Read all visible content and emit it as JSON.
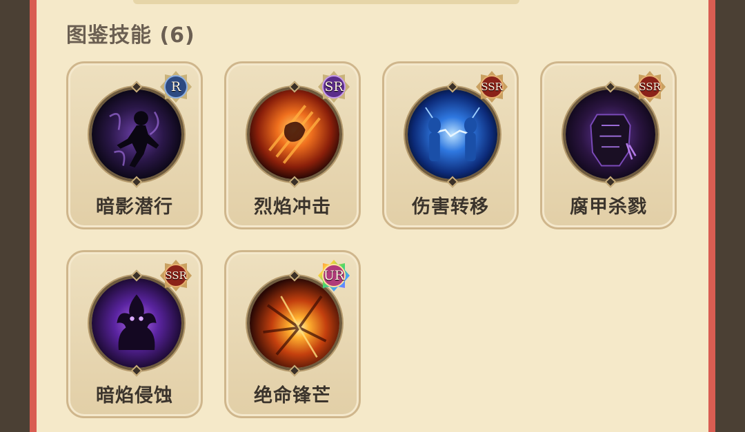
{
  "section": {
    "title": "图鉴技能 (6)"
  },
  "skills": [
    {
      "name": "暗影潜行",
      "rarity": "R",
      "rarity_color": "#3a5a9a",
      "art": "shadow-runner-icon"
    },
    {
      "name": "烈焰冲击",
      "rarity": "SR",
      "rarity_color": "#6a3a9a",
      "art": "flame-strike-icon"
    },
    {
      "name": "伤害转移",
      "rarity": "SSR",
      "rarity_color": "#9a2a22",
      "art": "lightning-twins-icon"
    },
    {
      "name": "腐甲杀戮",
      "rarity": "SSR",
      "rarity_color": "#9a2a22",
      "art": "corrupted-armor-icon"
    },
    {
      "name": "暗焰侵蚀",
      "rarity": "SSR",
      "rarity_color": "#9a2a22",
      "art": "dark-flame-demon-icon"
    },
    {
      "name": "绝命锋芒",
      "rarity": "UR",
      "rarity_color": "#d24a8a",
      "art": "explosion-burst-icon"
    }
  ],
  "colors": {
    "panel_bg": "#f5e9c9",
    "card_border": "#cfb68c",
    "frame_red": "#d95d52",
    "text_dark": "#3b342c"
  }
}
